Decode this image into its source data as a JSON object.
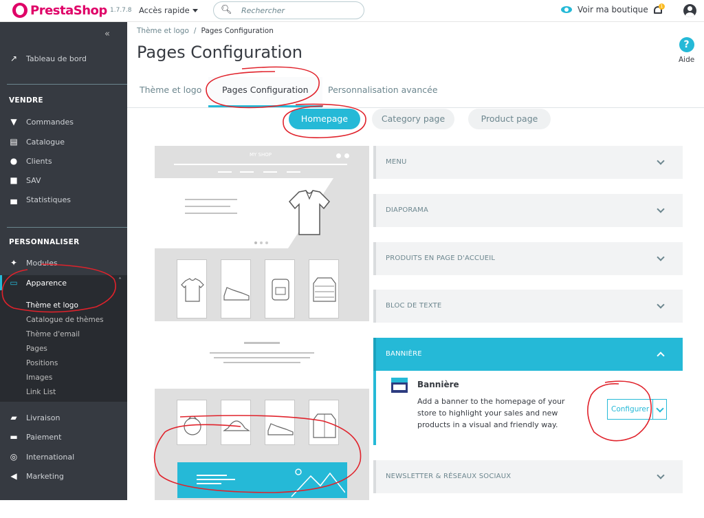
{
  "topbar": {
    "brand": "PrestaShop",
    "version": "1.7.7.8",
    "quick_access": "Accès rapide",
    "search_placeholder": "Rechercher",
    "view_shop": "Voir ma boutique",
    "notification_count": "1"
  },
  "sidebar": {
    "dashboard": "Tableau de bord",
    "section_sell": "VENDRE",
    "sell_items": [
      "Commandes",
      "Catalogue",
      "Clients",
      "SAV",
      "Statistiques"
    ],
    "section_customize": "PERSONNALISER",
    "modules": "Modules",
    "appearance": "Apparence",
    "appearance_sub": [
      "Thème et logo",
      "Catalogue de thèmes",
      "Thème d'email",
      "Pages",
      "Positions",
      "Images",
      "Link List"
    ],
    "bottom_items": [
      "Livraison",
      "Paiement",
      "International",
      "Marketing"
    ]
  },
  "header": {
    "breadcrumb": [
      "Thème et logo",
      "Pages Configuration"
    ],
    "title": "Pages Configuration",
    "help": "Aide"
  },
  "tabs": [
    "Thème et logo",
    "Pages Configuration",
    "Personnalisation avancée"
  ],
  "page_tabs": [
    "Homepage",
    "Category page",
    "Product page"
  ],
  "preview": {
    "shop_name": "MY SHOP"
  },
  "sections": [
    {
      "title": "MENU",
      "open": false
    },
    {
      "title": "DIAPORAMA",
      "open": false
    },
    {
      "title": "PRODUITS EN PAGE D'ACCUEIL",
      "open": false
    },
    {
      "title": "BLOC DE TEXTE",
      "open": false
    },
    {
      "title": "BANNIÈRE",
      "open": true
    },
    {
      "title": "NEWSLETTER & RÉSEAUX SOCIAUX",
      "open": false
    }
  ],
  "banner_module": {
    "name": "Bannière",
    "description": "Add a banner to the homepage of your store to highlight your sales and new products in a visual and friendly way.",
    "configure": "Configurer"
  },
  "colors": {
    "accent": "#25b9d7",
    "sidebar": "#363a41",
    "brand": "#df0067",
    "annotation": "#e0222b"
  }
}
